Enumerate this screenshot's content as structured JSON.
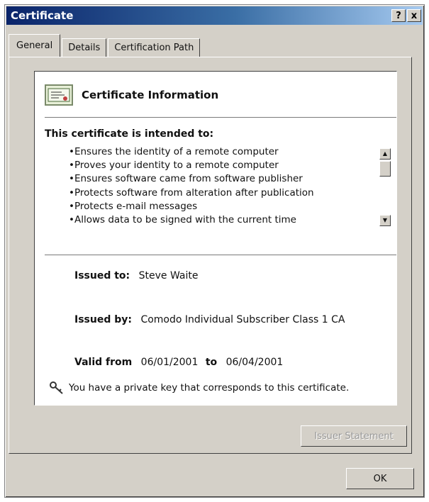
{
  "window": {
    "title": "Certificate",
    "help_label": "?",
    "close_label": "x"
  },
  "tabs": [
    {
      "label": "General"
    },
    {
      "label": "Details"
    },
    {
      "label": "Certification Path"
    }
  ],
  "info": {
    "heading": "Certificate Information",
    "intended_label": "This certificate is intended to:",
    "purposes": [
      "Ensures the identity of a remote computer",
      "Proves your identity to a remote computer",
      "Ensures software came from software publisher",
      "Protects software from alteration after publication",
      "Protects e-mail messages",
      "Allows data to be signed with the current time"
    ],
    "issued_to_label": "Issued to:",
    "issued_to_value": "Steve Waite",
    "issued_by_label": "Issued by:",
    "issued_by_value": "Comodo Individual Subscriber Class 1 CA",
    "valid_from_label": "Valid from",
    "valid_from_value": "06/01/2001",
    "valid_to_label": "to",
    "valid_to_value": "06/04/2001",
    "private_key_note": "You have a private key that corresponds to this certificate."
  },
  "buttons": {
    "issuer_statement": "Issuer Statement",
    "ok": "OK"
  }
}
